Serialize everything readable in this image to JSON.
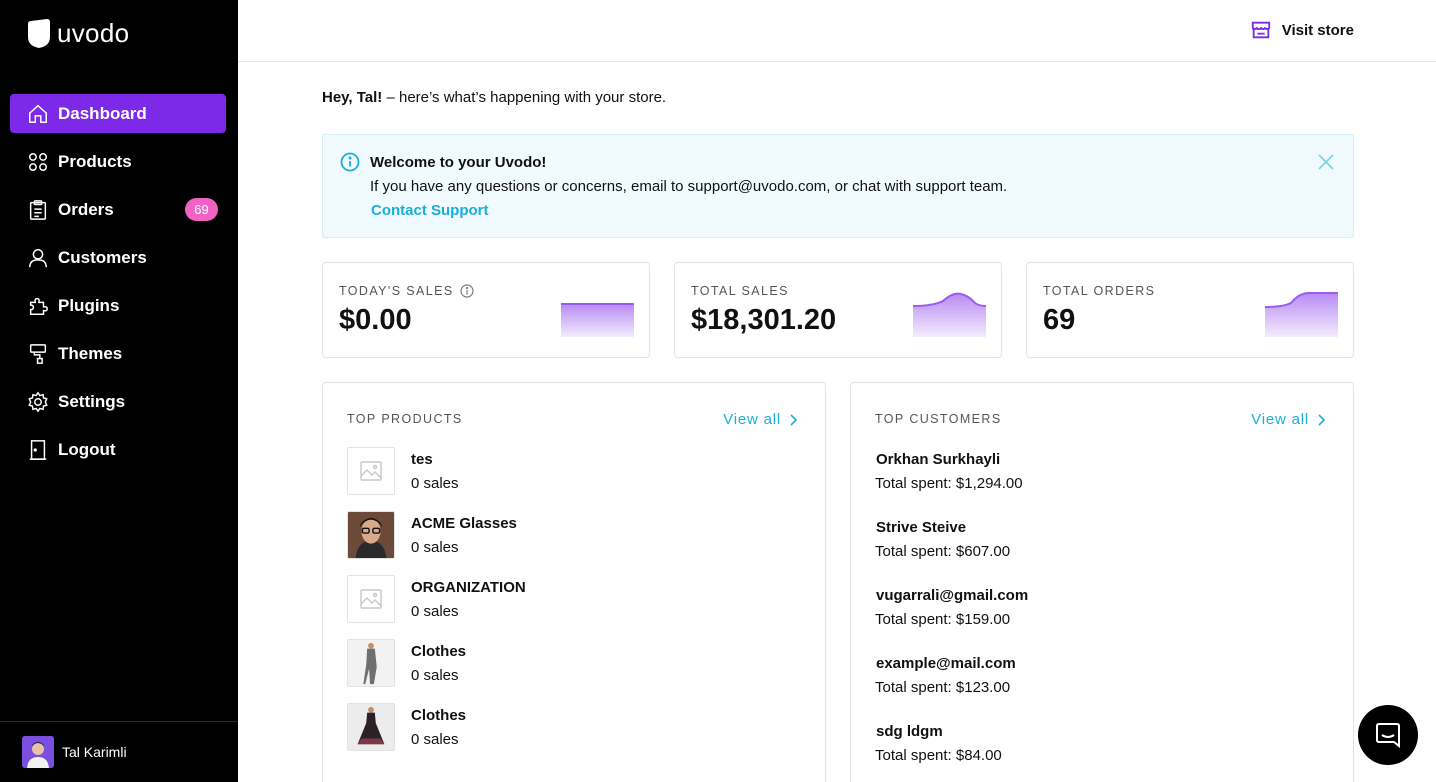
{
  "app": {
    "brand": "uvodo"
  },
  "sidebar": {
    "items": [
      {
        "label": "Dashboard",
        "icon": "home-icon",
        "active": true
      },
      {
        "label": "Products",
        "icon": "grid-icon"
      },
      {
        "label": "Orders",
        "icon": "clipboard-icon",
        "badge": "69"
      },
      {
        "label": "Customers",
        "icon": "user-icon"
      },
      {
        "label": "Plugins",
        "icon": "puzzle-icon"
      },
      {
        "label": "Themes",
        "icon": "paint-roller-icon"
      },
      {
        "label": "Settings",
        "icon": "gear-icon"
      },
      {
        "label": "Logout",
        "icon": "door-icon"
      }
    ],
    "user": {
      "name": "Tal Karimli"
    }
  },
  "header": {
    "visit_store": "Visit store"
  },
  "greeting": {
    "name": "Hey, Tal!",
    "text": " – here’s what’s happening with your store."
  },
  "banner": {
    "title": "Welcome to your Uvodo!",
    "text": "If you have any questions or concerns, email to support@uvodo.com, or chat with support team.",
    "link": "Contact Support"
  },
  "stats": [
    {
      "label": "TODAY'S SALES",
      "value": "$0.00",
      "info": true
    },
    {
      "label": "TOTAL SALES",
      "value": "$18,301.20"
    },
    {
      "label": "TOTAL ORDERS",
      "value": "69"
    }
  ],
  "top_products": {
    "title": "TOP PRODUCTS",
    "view_all": "View all",
    "items": [
      {
        "name": "tes",
        "sub": "0 sales",
        "thumb": "placeholder"
      },
      {
        "name": "ACME Glasses",
        "sub": "0 sales",
        "thumb": "photo"
      },
      {
        "name": "ORGANIZATION",
        "sub": "0 sales",
        "thumb": "placeholder"
      },
      {
        "name": "Clothes",
        "sub": "0 sales",
        "thumb": "photo"
      },
      {
        "name": "Clothes",
        "sub": "0 sales",
        "thumb": "photo"
      }
    ]
  },
  "top_customers": {
    "title": "TOP CUSTOMERS",
    "view_all": "View all",
    "items": [
      {
        "name": "Orkhan Surkhayli",
        "sub": "Total spent: $1,294.00"
      },
      {
        "name": "Strive Steive",
        "sub": "Total spent: $607.00"
      },
      {
        "name": "vugarrali@gmail.com",
        "sub": "Total spent: $159.00"
      },
      {
        "name": "example@mail.com",
        "sub": "Total spent: $123.00"
      },
      {
        "name": "sdg ldgm",
        "sub": "Total spent: $84.00"
      }
    ]
  },
  "colors": {
    "accent": "#7c2ae8",
    "link": "#17b0d8",
    "badge": "#f062c4"
  }
}
